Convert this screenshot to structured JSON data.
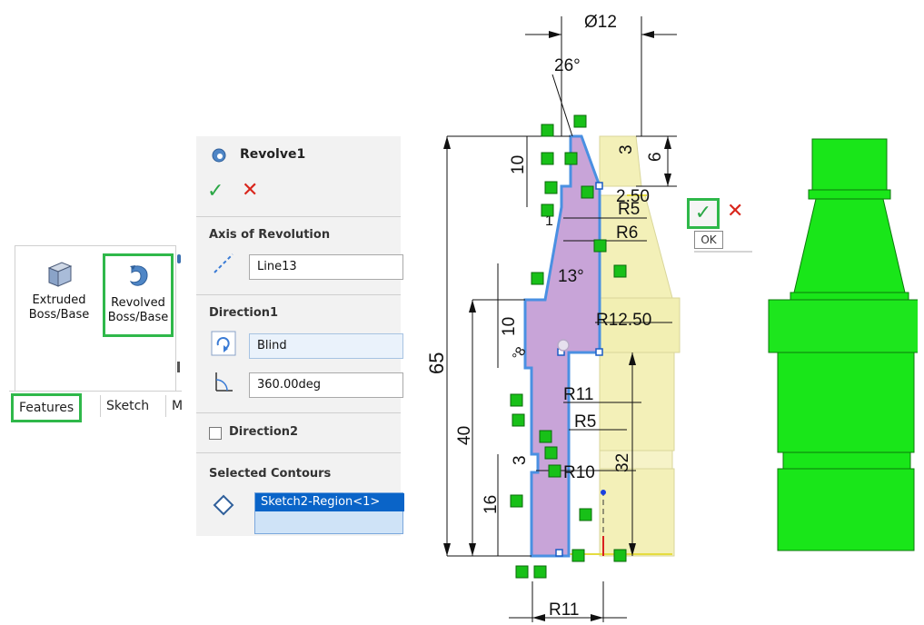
{
  "ribbon": {
    "extrude_label": "Extruded Boss/Base",
    "revolve_label": "Revolved Boss/Base",
    "tabs": [
      "Features",
      "Sketch",
      "M"
    ]
  },
  "property_manager": {
    "title": "Revolve1",
    "axis_section": "Axis of Revolution",
    "axis_value": "Line13",
    "direction1_section": "Direction1",
    "end_condition": "Blind",
    "angle_value": "360.00deg",
    "direction2_label": "Direction2",
    "contours_section": "Selected Contours",
    "contour_item": "Sketch2-Region<1>"
  },
  "confirm": {
    "ok_tooltip": "OK"
  },
  "sketch_dimensions": {
    "diameter_top": "Ø12",
    "angle_top": "26°",
    "d10_top": "10",
    "d3": "3",
    "d6": "6",
    "d250": "2.50",
    "r5_top": "R5",
    "r6": "R6",
    "d1": "1",
    "angle_mid": "13°",
    "r1250": "R12.50",
    "d10_mid": "10",
    "angle_small": "°8",
    "d65": "65",
    "r11_mid": "R11",
    "d40": "40",
    "r5_low": "R5",
    "d3_low": "3",
    "r10": "R10",
    "d32": "32",
    "d16": "16",
    "r11_bottom": "R11"
  },
  "colors": {
    "accent_green": "#2fb84a",
    "solid_green": "#19e619",
    "profile_fill": "#c8a4d8",
    "revolved_preview": "#f3f0b8",
    "sketch_blue": "#4a90e2",
    "selection_blue": "#0a64c8"
  },
  "icons": [
    "extrude-icon",
    "revolve-icon",
    "revolve-title-icon",
    "axis-line-icon",
    "reverse-direction-icon",
    "angle-icon",
    "contour-diamond-icon",
    "check-icon",
    "close-icon"
  ]
}
